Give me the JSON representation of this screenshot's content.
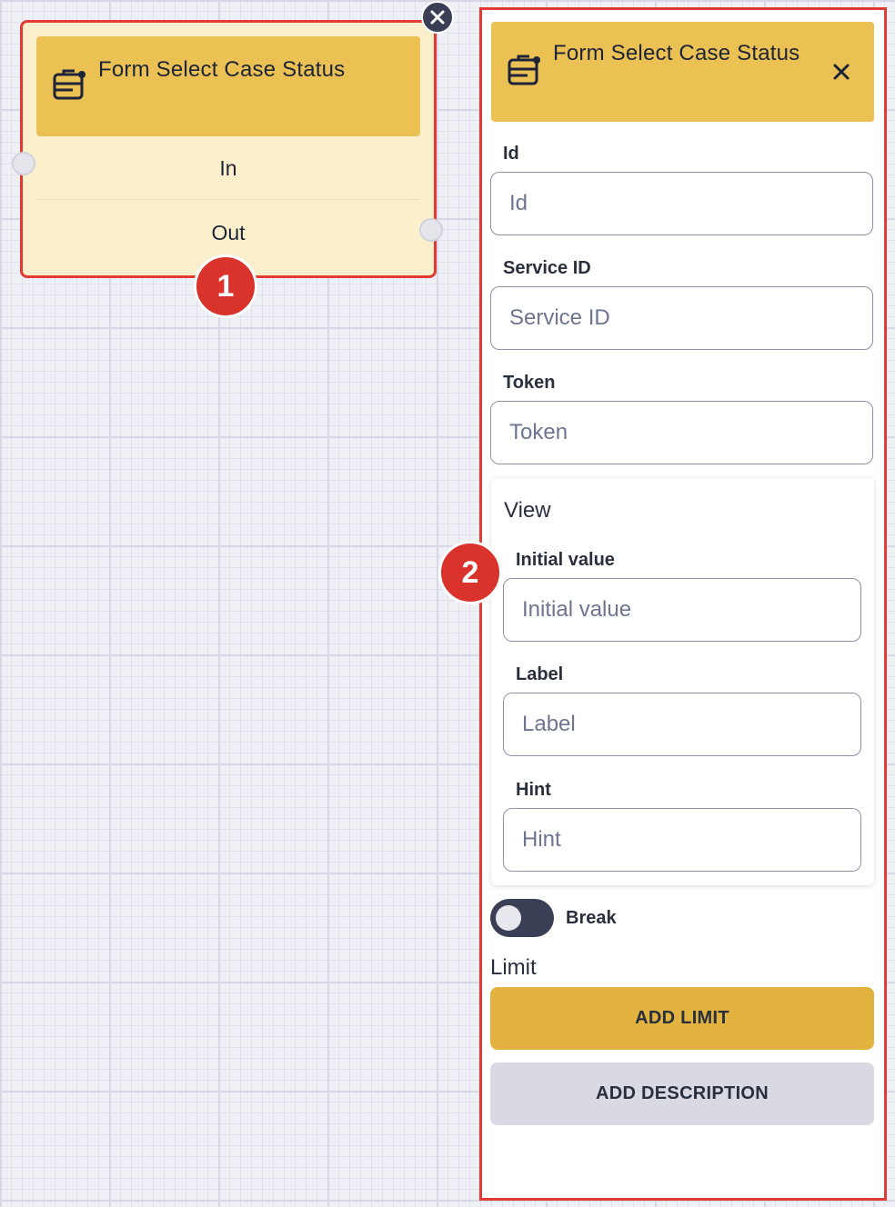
{
  "node": {
    "title": "Form Select Case Status",
    "icon": "form-select-icon",
    "ports": {
      "in_label": "In",
      "out_label": "Out"
    },
    "close_icon": "close-icon"
  },
  "callouts": {
    "node_badge": "1",
    "panel_badge": "2"
  },
  "panel": {
    "title": "Form Select Case Status",
    "close_icon": "close-icon",
    "fields": [
      {
        "label": "Id",
        "placeholder": "Id",
        "value": ""
      },
      {
        "label": "Service ID",
        "placeholder": "Service ID",
        "value": ""
      },
      {
        "label": "Token",
        "placeholder": "Token",
        "value": ""
      }
    ],
    "view": {
      "title": "View",
      "fields": [
        {
          "label": "Initial value",
          "placeholder": "Initial value",
          "value": ""
        },
        {
          "label": "Label",
          "placeholder": "Label",
          "value": ""
        },
        {
          "label": "Hint",
          "placeholder": "Hint",
          "value": ""
        }
      ]
    },
    "break_toggle": {
      "label": "Break",
      "on": false
    },
    "limit": {
      "title": "Limit",
      "add_limit_label": "ADD LIMIT",
      "add_description_label": "ADD DESCRIPTION"
    }
  },
  "colors": {
    "accent_yellow": "#ebc154",
    "button_yellow": "#e2b33f",
    "node_body": "#fcf0cc",
    "highlight_red": "#e23b33",
    "badge_red": "#d9332c",
    "dark": "#3a3f55",
    "secondary_button": "#d8d9e3"
  }
}
